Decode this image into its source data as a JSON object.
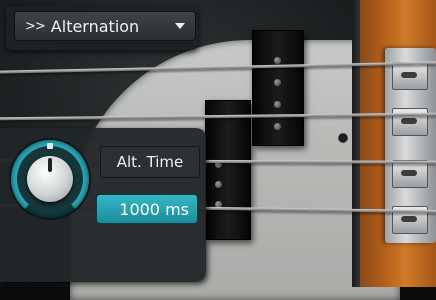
{
  "articulation_menu": {
    "prefix": ">>",
    "selected": "Alternation"
  },
  "alt_time": {
    "label": "Alt. Time",
    "value": "1000 ms"
  },
  "colors": {
    "accent": "#2aa7b8",
    "panel": "#222628",
    "neck_wood": "#c06e24"
  }
}
